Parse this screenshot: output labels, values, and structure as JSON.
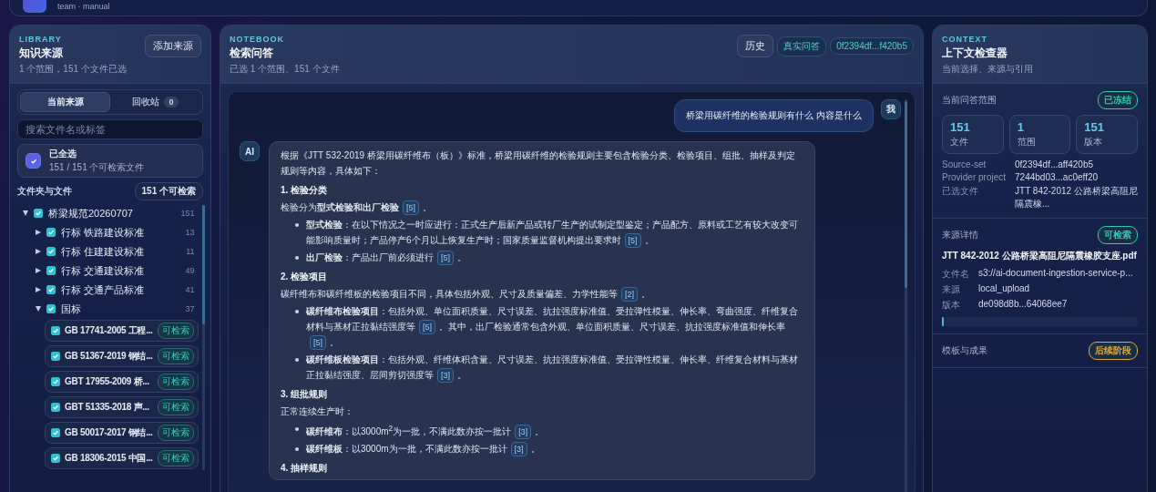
{
  "header": {
    "subtitle": "team · manual"
  },
  "library": {
    "eyebrow": "LIBRARY",
    "title": "知识来源",
    "subtitle": "1 个范围，151 个文件已选",
    "add_button": "添加来源",
    "tabs": [
      {
        "label": "当前来源",
        "selected": true
      },
      {
        "label": "回收站",
        "count": "0",
        "selected": false
      }
    ],
    "search": {
      "placeholder": "搜索文件名或标签"
    },
    "select_all": {
      "checked": true,
      "title": "已全选",
      "subtitle": "151 / 151 个可检索文件"
    },
    "tree_heading": "文件夹与文件",
    "tree_badge": "151 个可检索",
    "tree": [
      {
        "kind": "folder",
        "label": "桥梁规范20260707",
        "count": "151",
        "checked": true,
        "expanded": true,
        "children": [
          {
            "kind": "folder",
            "label": "行标 铁路建设标准",
            "count": "13",
            "checked": true,
            "expanded": false
          },
          {
            "kind": "folder",
            "label": "行标 住建建设标准",
            "count": "11",
            "checked": true,
            "expanded": false
          },
          {
            "kind": "folder",
            "label": "行标 交通建设标准",
            "count": "49",
            "checked": true,
            "expanded": false
          },
          {
            "kind": "folder",
            "label": "行标 交通产品标准",
            "count": "41",
            "checked": true,
            "expanded": false
          },
          {
            "kind": "folder",
            "label": "国标",
            "count": "37",
            "checked": true,
            "expanded": true,
            "children": [
              {
                "kind": "file",
                "label": "GB 17741-2005 工程...",
                "checked": true,
                "tag": "可检索"
              },
              {
                "kind": "file",
                "label": "GB 51367-2019 钢结...",
                "checked": true,
                "tag": "可检索"
              },
              {
                "kind": "file",
                "label": "GBT 17955-2009 桥...",
                "checked": true,
                "tag": "可检索"
              },
              {
                "kind": "file",
                "label": "GBT 51335-2018 声...",
                "checked": true,
                "tag": "可检索"
              },
              {
                "kind": "file",
                "label": "GB 50017-2017 钢结...",
                "checked": true,
                "tag": "可检索"
              },
              {
                "kind": "file",
                "label": "GB 18306-2015 中国...",
                "checked": true,
                "tag": "可检索"
              }
            ]
          }
        ]
      }
    ]
  },
  "notebook": {
    "eyebrow": "NOTEBOOK",
    "title": "检索问答",
    "subtitle": "已选 1 个范围、151 个文件",
    "history_button": "历史",
    "tags": [
      "真实问答",
      "0f2394df...f420b5"
    ],
    "messages": [
      {
        "kind": "user",
        "avatar": "我",
        "text": "桥梁用碳纤维的检验规则有什么 内容是什么"
      },
      {
        "kind": "ai",
        "avatar": "AI",
        "blocks": [
          {
            "kind": "paragraph",
            "parts": [
              {
                "kind": "text",
                "text": "根据《JTT 532-2019 桥梁用碳纤维布（板）》标准，桥梁用碳纤维的检验规则主要包含检验分类、检验项目、组批、抽样及判定规则等内容，具体如下："
              }
            ]
          },
          {
            "kind": "heading",
            "parts": [
              {
                "kind": "text",
                "text": "1. 检验分类"
              }
            ]
          },
          {
            "kind": "paragraph",
            "parts": [
              {
                "kind": "text",
                "text": "检验分为**型式检验和出厂检验**"
              },
              {
                "kind": "cite",
                "text": "[5]"
              },
              {
                "kind": "text",
                "text": "。"
              }
            ]
          },
          {
            "kind": "bullet",
            "parts": [
              {
                "kind": "text",
                "text": "**型式检验**：在以下情况之一时应进行：正式生产后新产品或转厂生产的试制定型鉴定；产品配方、原料或工艺有较大改变可能影响质量时；产品停产6个月以上恢复生产时；国家质量监督机构提出要求时"
              },
              {
                "kind": "cite",
                "text": "[5]"
              },
              {
                "kind": "text",
                "text": "。"
              }
            ]
          },
          {
            "kind": "bullet",
            "parts": [
              {
                "kind": "text",
                "text": "**出厂检验**：产品出厂前必须进行"
              },
              {
                "kind": "cite",
                "text": "[5]"
              },
              {
                "kind": "text",
                "text": "。"
              }
            ]
          },
          {
            "kind": "heading",
            "parts": [
              {
                "kind": "text",
                "text": "2. 检验项目"
              }
            ]
          },
          {
            "kind": "paragraph",
            "parts": [
              {
                "kind": "text",
                "text": "碳纤维布和碳纤维板的检验项目不同，具体包括外观、尺寸及质量偏差、力学性能等"
              },
              {
                "kind": "cite",
                "text": "[2]"
              },
              {
                "kind": "text",
                "text": "。"
              }
            ]
          },
          {
            "kind": "bullet",
            "parts": [
              {
                "kind": "text",
                "text": "**碳纤维布检验项目**：包括外观、单位面积质量、尺寸误差、抗拉强度标准值、受拉弹性模量、伸长率、弯曲强度、纤维复合材料与基材正拉黏结强度等"
              },
              {
                "kind": "cite",
                "text": "[5]"
              },
              {
                "kind": "text",
                "text": "。其中，出厂检验通常包含外观、单位面积质量、尺寸误差、抗拉强度标准值和伸长率"
              },
              {
                "kind": "cite",
                "text": "[5]"
              },
              {
                "kind": "text",
                "text": "。"
              }
            ]
          },
          {
            "kind": "bullet",
            "parts": [
              {
                "kind": "text",
                "text": "**碳纤维板检验项目**：包括外观、纤维体积含量、尺寸误差、抗拉强度标准值、受拉弹性模量、伸长率、纤维复合材料与基材正拉黏结强度、层间剪切强度等"
              },
              {
                "kind": "cite",
                "text": "[3]"
              },
              {
                "kind": "text",
                "text": "。"
              }
            ]
          },
          {
            "kind": "heading",
            "parts": [
              {
                "kind": "text",
                "text": "3. 组批规则"
              }
            ]
          },
          {
            "kind": "paragraph",
            "parts": [
              {
                "kind": "text",
                "text": "正常连续生产时："
              }
            ]
          },
          {
            "kind": "bullet",
            "parts": [
              {
                "kind": "text",
                "text": "**碳纤维布**：以3000m$^{2}$为一批，不满此数亦按一批计"
              },
              {
                "kind": "cite",
                "text": "[3]"
              },
              {
                "kind": "text",
                "text": "。"
              }
            ]
          },
          {
            "kind": "bullet",
            "parts": [
              {
                "kind": "text",
                "text": "**碳纤维板**：以3000m为一批，不满此数亦按一批计"
              },
              {
                "kind": "cite",
                "text": "[3]"
              },
              {
                "kind": "text",
                "text": "。"
              }
            ]
          },
          {
            "kind": "heading",
            "parts": [
              {
                "kind": "text",
                "text": "4. 抽样规则"
              }
            ]
          }
        ]
      }
    ]
  },
  "context": {
    "eyebrow": "CONTEXT",
    "title": "上下文检查器",
    "subtitle": "当前选择、来源与引用",
    "scope": {
      "heading": "当前问答范围",
      "tag": {
        "text": "已冻结",
        "color": "#34c9b4"
      },
      "stats": [
        {
          "value": "151",
          "label": "文件"
        },
        {
          "value": "1",
          "label": "范围"
        },
        {
          "value": "151",
          "label": "版本"
        }
      ],
      "rows": [
        {
          "key": "Source-set",
          "value": "0f2394df...aff420b5"
        },
        {
          "key": "Provider project",
          "value": "7244bd03...ac0eff20"
        },
        {
          "key": "已选文件",
          "value": "JTT 842-2012 公路桥梁高阻尼隔震橡..."
        }
      ]
    },
    "source": {
      "heading": "来源详情",
      "tag": {
        "text": "可检索",
        "color": "#34c9b4"
      },
      "file_title": "JTT 842-2012 公路桥梁高阻尼隔震橡胶支座.pdf",
      "rows": [
        {
          "key": "文件名",
          "value": "s3://ai-document-ingestion-service-p..."
        },
        {
          "key": "来源",
          "value": "local_upload"
        },
        {
          "key": "版本",
          "value": "de098d8b...64068ee7"
        }
      ],
      "level": 0.01
    },
    "outputs": {
      "heading": "模板与成果",
      "tag": {
        "text": "后续阶段",
        "color": "#e2a93a"
      }
    }
  }
}
